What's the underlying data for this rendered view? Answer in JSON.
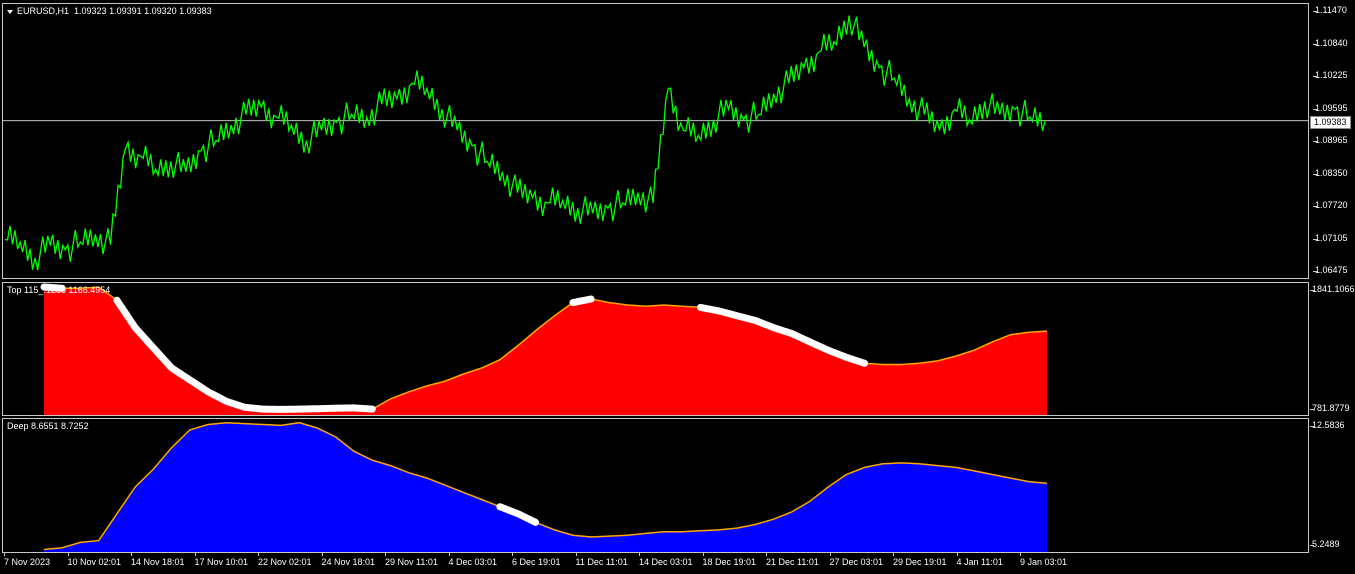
{
  "main": {
    "symbol_label": "EURUSD,H1",
    "ohlc": "1.09323 1.09391 1.09320 1.09383",
    "current_price": "1.09383",
    "price_ticks": [
      "1.11470",
      "1.10840",
      "1.10225",
      "1.09595",
      "1.08965",
      "1.08350",
      "1.07720",
      "1.07105",
      "1.06475"
    ],
    "line_color": "#00ff00",
    "price_line_color": "#c0c0c0"
  },
  "top": {
    "label": "Top 115_.1288 1166.4954",
    "max": "1841.1066",
    "min": "781.8779",
    "fill_color": "#ff0000",
    "edge_color": "#ffa500",
    "marker_color": "#ffffff"
  },
  "deep": {
    "label": "Deep 8.6551 8.7252",
    "max": "12.5836",
    "min": "5.2489",
    "fill_color": "#0000ff",
    "edge_color": "#ffa500",
    "marker_color": "#ffffff"
  },
  "time_ticks": [
    "7 Nov 2023",
    "10 Nov 02:01",
    "14 Nov 18:01",
    "17 Nov 10:01",
    "22 Nov 02:01",
    "24 Nov 18:01",
    "29 Nov 11:01",
    "4 Dec 03:01",
    "6 Dec 19:01",
    "11 Dec 11:01",
    "14 Dec 03:01",
    "18 Dec 19:01",
    "21 Dec 11:01",
    "27 Dec 03:01",
    "29 Dec 19:01",
    "4 Jan 11:01",
    "9 Jan 03:01"
  ],
  "chart_data": [
    {
      "type": "line",
      "title": "EURUSD,H1",
      "ylim": [
        1.06475,
        1.1147
      ],
      "series": [
        {
          "name": "EURUSD",
          "values": [
            1.071,
            1.0705,
            1.0675,
            1.07,
            1.069,
            1.0705,
            1.072,
            1.07,
            1.0885,
            1.087,
            1.0845,
            1.086,
            1.084,
            1.088,
            1.09,
            1.093,
            1.095,
            1.0965,
            1.0945,
            1.093,
            1.09,
            1.092,
            1.0935,
            1.095,
            1.0945,
            1.097,
            1.098,
            1.101,
            1.1,
            1.096,
            1.092,
            1.089,
            1.086,
            1.084,
            1.08,
            1.079,
            1.078,
            1.0785,
            1.077,
            1.076,
            1.077,
            1.078,
            1.08,
            1.078,
            1.1,
            1.092,
            1.091,
            1.094,
            1.096,
            1.094,
            1.095,
            1.099,
            1.101,
            1.104,
            1.107,
            1.109,
            1.114,
            1.108,
            1.104,
            1.102,
            1.098,
            1.095,
            1.092,
            1.096,
            1.094,
            1.0975,
            1.095,
            1.096,
            1.0945,
            1.0938
          ]
        }
      ]
    },
    {
      "type": "area",
      "title": "Top",
      "ylim": [
        781.8779,
        1841.1066
      ],
      "series": [
        {
          "name": "Top",
          "values": [
            1841,
            1830,
            1830,
            1840,
            1730,
            1500,
            1330,
            1160,
            1060,
            960,
            880,
            830,
            815,
            812,
            815,
            818,
            822,
            825,
            815,
            900,
            960,
            1010,
            1050,
            1110,
            1160,
            1230,
            1350,
            1480,
            1600,
            1710,
            1740,
            1710,
            1690,
            1680,
            1690,
            1680,
            1670,
            1640,
            1600,
            1560,
            1500,
            1450,
            1380,
            1310,
            1250,
            1200,
            1190,
            1190,
            1200,
            1220,
            1260,
            1310,
            1380,
            1440,
            1460,
            1470
          ]
        }
      ]
    },
    {
      "type": "area",
      "title": "Deep",
      "ylim": [
        5.2489,
        12.5836
      ],
      "series": [
        {
          "name": "Deep",
          "values": [
            5.5,
            5.6,
            5.9,
            6.0,
            7.5,
            9.0,
            10.0,
            11.2,
            12.2,
            12.5,
            12.6,
            12.55,
            12.5,
            12.45,
            12.6,
            12.3,
            11.8,
            11.0,
            10.5,
            10.2,
            9.8,
            9.5,
            9.1,
            8.7,
            8.3,
            7.9,
            7.5,
            7.0,
            6.6,
            6.3,
            6.2,
            6.25,
            6.3,
            6.4,
            6.5,
            6.5,
            6.55,
            6.6,
            6.7,
            6.9,
            7.2,
            7.6,
            8.2,
            9.0,
            9.7,
            10.1,
            10.3,
            10.35,
            10.3,
            10.2,
            10.1,
            9.9,
            9.7,
            9.5,
            9.3,
            9.2
          ]
        }
      ]
    }
  ]
}
